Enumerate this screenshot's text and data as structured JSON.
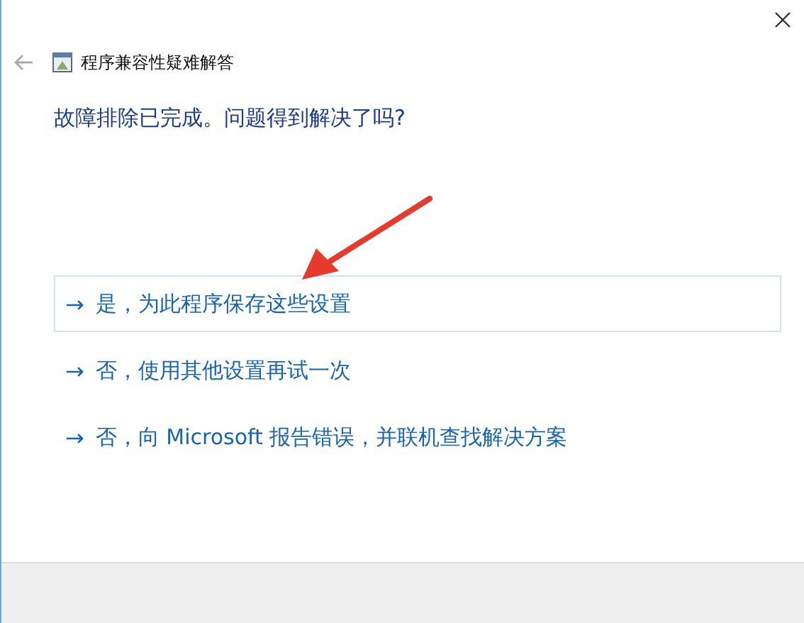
{
  "window": {
    "title": "程序兼容性疑难解答"
  },
  "heading": "故障排除已完成。问题得到解决了吗?",
  "options": [
    {
      "icon": "→",
      "label": "是，为此程序保存这些设置",
      "selected": true
    },
    {
      "icon": "→",
      "label": "否，使用其他设置再试一次",
      "selected": false
    },
    {
      "icon": "→",
      "label": "否，向 Microsoft 报告错误，并联机查找解决方案",
      "selected": false
    }
  ],
  "annotation": {
    "kind": "arrow"
  }
}
